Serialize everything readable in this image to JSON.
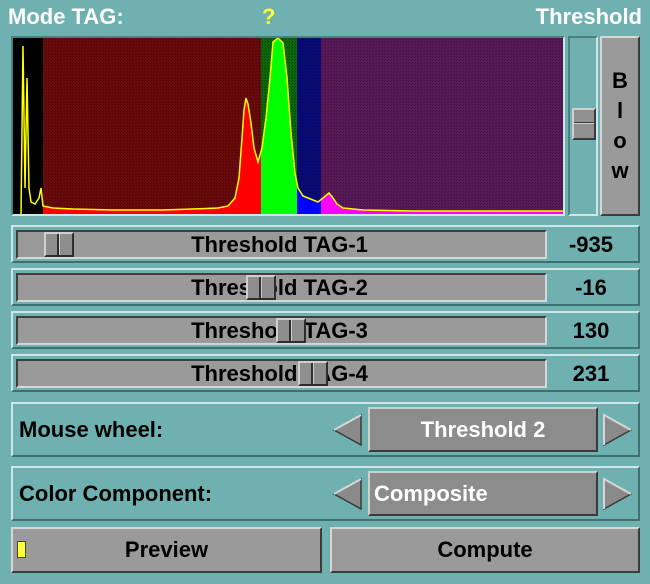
{
  "header": {
    "mode_label": "Mode TAG:",
    "help_label": "?",
    "mode_value": "Threshold"
  },
  "blow_button": {
    "letters": [
      "B",
      "l",
      "o",
      "w"
    ]
  },
  "thresholds": [
    {
      "label": "Threshold TAG-1",
      "value": "-935"
    },
    {
      "label": "Threshold TAG-2",
      "value": "-16"
    },
    {
      "label": "Threshold TAG-3",
      "value": "130"
    },
    {
      "label": "Threshold TAG-4",
      "value": "231"
    }
  ],
  "mouse_wheel": {
    "label": "Mouse wheel:",
    "value": "Threshold 2"
  },
  "color_component": {
    "label": "Color Component:",
    "value": "Composite"
  },
  "buttons": {
    "preview": "Preview",
    "compute": "Compute"
  },
  "histogram": {
    "colors": {
      "tag0": "#000000",
      "tag1": "#ff0000",
      "tag2": "#00ff00",
      "tag3": "#0000ff",
      "tag4": "#ff00ff",
      "curve": "#ffff00"
    }
  }
}
